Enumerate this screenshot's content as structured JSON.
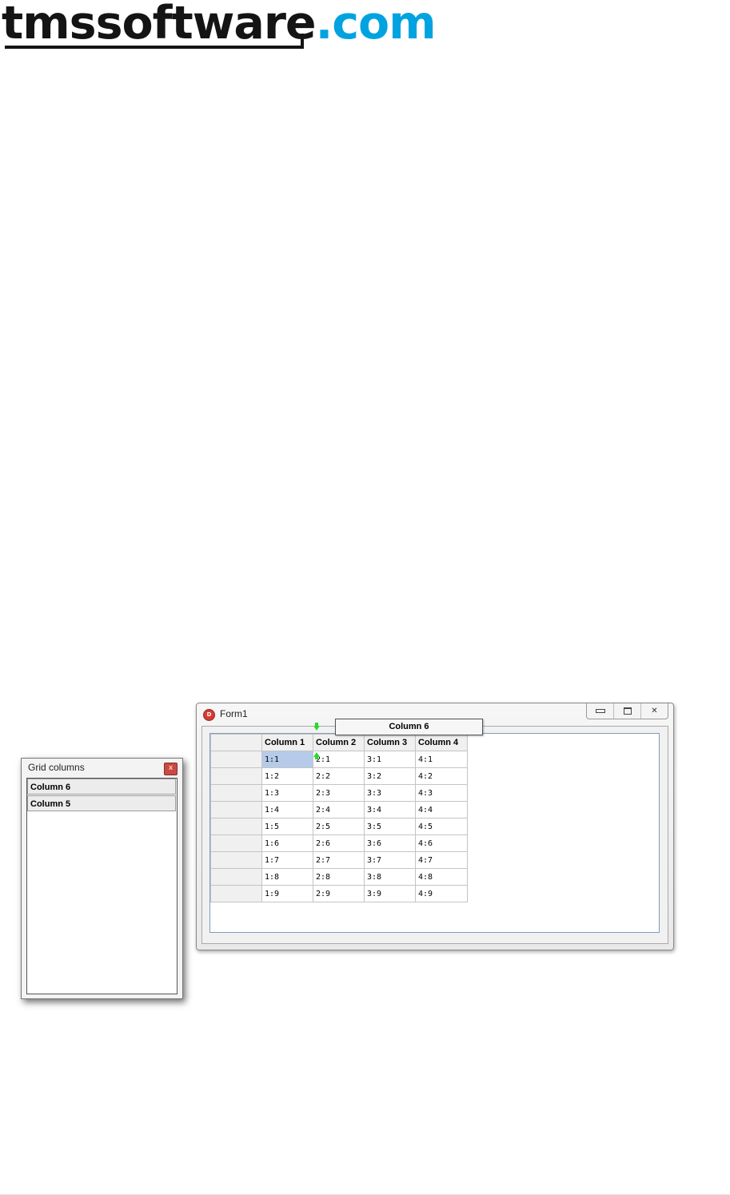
{
  "logo": {
    "main": "tmssoftware",
    "dot": ".",
    "tld": "com"
  },
  "grid_columns_window": {
    "title": "Grid columns",
    "close_glyph": "x",
    "items": [
      "Column 6",
      "Column 5"
    ]
  },
  "form": {
    "title": "Form1",
    "icon_letter": "D",
    "controls": {
      "minimize": "minimize-icon",
      "restore": "restore-icon",
      "close": "✕"
    },
    "dragged_header": "Column 6",
    "grid": {
      "headers": [
        "",
        "Column 1",
        "Column 2",
        "Column 3",
        "Column 4"
      ],
      "rows": [
        [
          "",
          "1:1",
          "2:1",
          "3:1",
          "4:1"
        ],
        [
          "",
          "1:2",
          "2:2",
          "3:2",
          "4:2"
        ],
        [
          "",
          "1:3",
          "2:3",
          "3:3",
          "4:3"
        ],
        [
          "",
          "1:4",
          "2:4",
          "3:4",
          "4:4"
        ],
        [
          "",
          "1:5",
          "2:5",
          "3:5",
          "4:5"
        ],
        [
          "",
          "1:6",
          "2:6",
          "3:6",
          "4:6"
        ],
        [
          "",
          "1:7",
          "2:7",
          "3:7",
          "4:7"
        ],
        [
          "",
          "1:8",
          "2:8",
          "3:8",
          "4:8"
        ],
        [
          "",
          "1:9",
          "2:9",
          "3:9",
          "4:9"
        ]
      ],
      "selected_cell": "1:1"
    }
  },
  "colors": {
    "accent": "#00a3e0",
    "selection": "#b6cbe9",
    "drop_arrow": "#2fd62f",
    "close_button": "#c94a42"
  }
}
